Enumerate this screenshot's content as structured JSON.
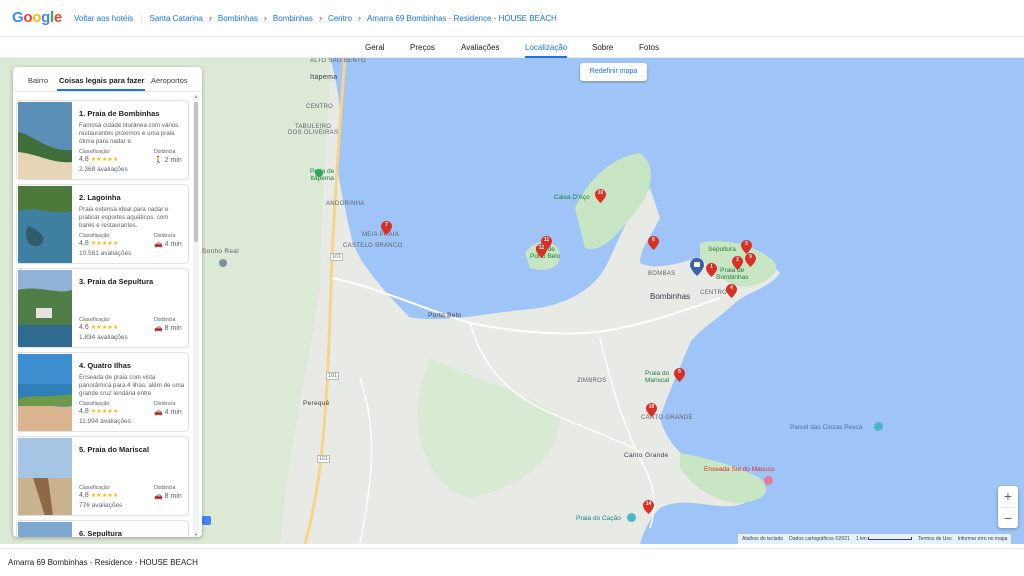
{
  "header": {
    "logo_text": "Google",
    "logo_colors": [
      "#4285f4",
      "#ea4335",
      "#fbbc05",
      "#4285f4",
      "#34a853",
      "#ea4335"
    ],
    "back_link": "Voltar aos hotéis",
    "breadcrumbs": [
      "Santa Catarina",
      "Bombinhas",
      "Bombinhas",
      "Centro",
      "Amarra 69 Bombinhas - Residence - HOUSE BEACH"
    ]
  },
  "tabs": [
    "Geral",
    "Preços",
    "Avaliações",
    "Localização",
    "Sobre",
    "Fotos"
  ],
  "active_tab": "Localização",
  "panel": {
    "tabs": [
      "Bairro",
      "Coisas legais para fazer",
      "Aeroportos"
    ],
    "active_tab": "Coisas legais para fazer",
    "rating_label": "Classificação",
    "distance_label": "Distância",
    "places": [
      {
        "title": "1. Praia de Bombinhas",
        "description": "Famosa cidade litorânea com vários restaurantes próximos e uma praia ótima para nadar e",
        "rating": "4,8",
        "stars": "★★★★★",
        "distance": "2 min",
        "mode": "walk-icon",
        "reviews": "2.368 avaliações"
      },
      {
        "title": "2. Lagoinha",
        "description": "Praia extensa ideal para nadar e praticar esportes aquáticos, com bares e restaurantes.",
        "rating": "4,8",
        "stars": "★★★★★",
        "distance": "4 min",
        "mode": "car-icon",
        "reviews": "10.581 avaliações"
      },
      {
        "title": "3. Praia da Sepultura",
        "description": "",
        "rating": "4,6",
        "stars": "★★★★★",
        "distance": "8 min",
        "mode": "car-icon",
        "reviews": "1.834 avaliações"
      },
      {
        "title": "4. Quatro Ilhas",
        "description": "Enseada de praia com vista panorâmica para 4 ilhas, além de uma grande cruz lendária entre",
        "rating": "4,8",
        "stars": "★★★★★",
        "distance": "4 min",
        "mode": "car-icon",
        "reviews": "11.994 avaliações"
      },
      {
        "title": "5. Praia do Mariscal",
        "description": "",
        "rating": "4,8",
        "stars": "★★★★★",
        "distance": "8 min",
        "mode": "car-icon",
        "reviews": "776 avaliações"
      },
      {
        "title": "6. Sepultura",
        "description": "",
        "rating": "",
        "stars": "",
        "distance": "",
        "mode": "car-icon",
        "reviews": ""
      }
    ]
  },
  "map": {
    "reset_button": "Redefinir mapa",
    "labels": {
      "alto_sao_bento": "ALTO SÃO BENTO",
      "itapema": "Itapema",
      "centro_itapema": "CENTRO",
      "tabuleiro": "TABULEIRO\nDOS OLIVEIRAS",
      "praia_itapema": "Praia de\nItapema",
      "andorinha": "ANDORINHA",
      "meia_praia": "MEIA PRAIA",
      "castelo_branco": "CASTELO BRANCO",
      "sonho_real": "Sonho Real",
      "porto_belo": "Porto Belo",
      "perequê": "Perequê",
      "caixa_daco": "Caixa D'Aço",
      "ilha_porto_belo": "Ilha de\nPorto Belo",
      "bombas": "BOMBAS",
      "bombinhas": "Bombinhas",
      "centro": "CENTRO",
      "sepultura": "Sepultura",
      "praia_bombinhas": "Praia de\nBombinhas",
      "zimbros": "ZIMBROS",
      "praia_mariscal": "Praia do\nMariscal",
      "canto_grande_upper": "CANTO GRANDE",
      "canto_grande": "Canto Grande",
      "enseada": "Enseada Sul do Macuco",
      "parcel": "Parcel das Cinzas Pesca",
      "praia_cacao": "Praia do Cação",
      "road_101_a": "101",
      "road_101_b": "101",
      "road_101_c": "101"
    },
    "pins": [
      "1",
      "2",
      "4",
      "5",
      "6",
      "7",
      "8",
      "9",
      "10",
      "11",
      "12",
      "13",
      "14"
    ],
    "zoom_in": "+",
    "zoom_out": "−",
    "attribution": {
      "shortcuts": "Atalhos do teclado",
      "data": "Dados cartográficos ©2021",
      "scale": "1 km",
      "terms": "Termos de Uso",
      "report": "Informar erro no mapa"
    },
    "colors": {
      "water": "#9fc4f7",
      "land": "#e8eae6",
      "green": "#c8e6c4",
      "road": "#f8d487",
      "pin": "#d93025",
      "hotel_pin": "#3f63a8"
    }
  },
  "footer": {
    "title": "Amarra 69 Bombinhas - Residence - HOUSE BEACH"
  }
}
